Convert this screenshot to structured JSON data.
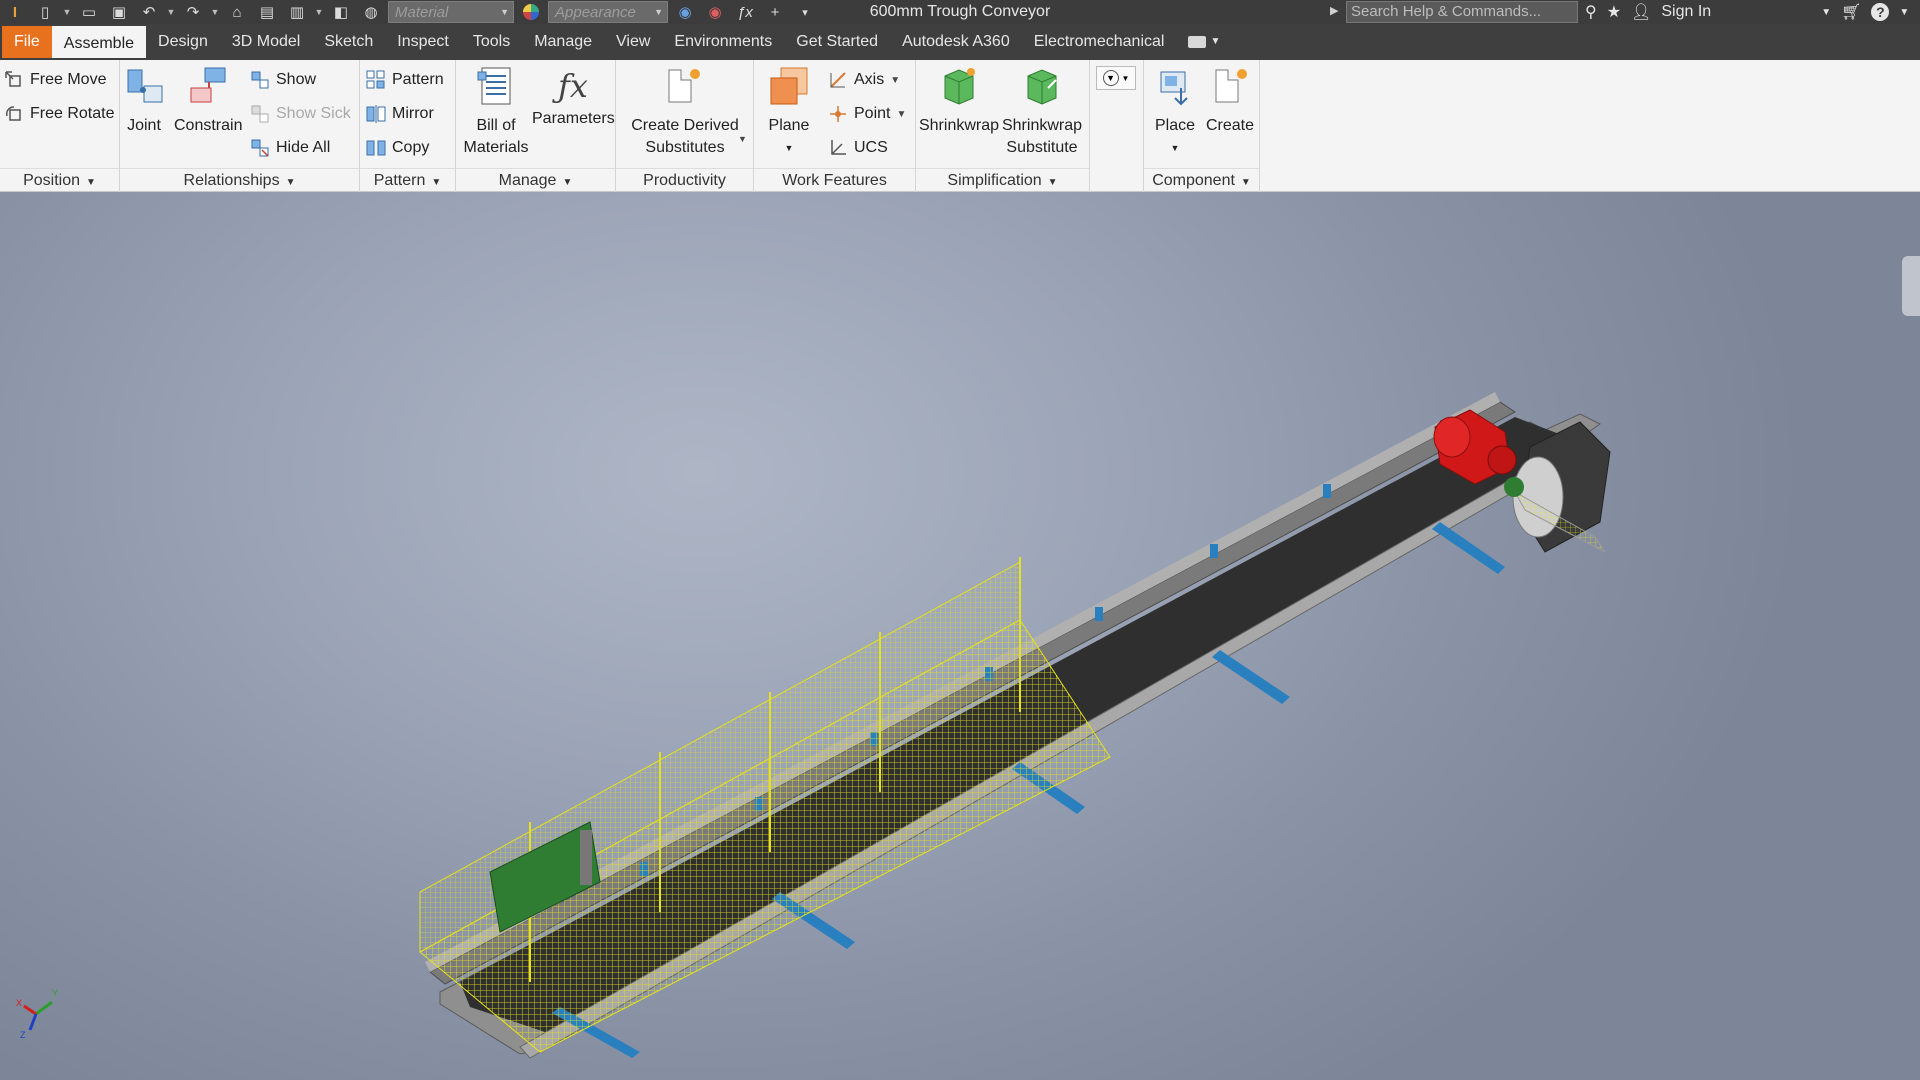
{
  "titlebar": {
    "document_title": "600mm Trough Conveyor",
    "material_placeholder": "Material",
    "appearance_placeholder": "Appearance",
    "search_placeholder": "Search Help & Commands...",
    "sign_in": "Sign In",
    "help": "?"
  },
  "tabs": [
    "File",
    "Assemble",
    "Design",
    "3D Model",
    "Sketch",
    "Inspect",
    "Tools",
    "Manage",
    "View",
    "Environments",
    "Get Started",
    "Autodesk A360",
    "Electromechanical"
  ],
  "active_tab": "Assemble",
  "ribbon": {
    "position": {
      "title": "Position",
      "free_move": "Free Move",
      "free_rotate": "Free Rotate"
    },
    "relationships": {
      "title": "Relationships",
      "joint": "Joint",
      "constrain": "Constrain",
      "show": "Show",
      "show_sick": "Show Sick",
      "hide_all": "Hide All"
    },
    "pattern": {
      "title": "Pattern",
      "pattern": "Pattern",
      "mirror": "Mirror",
      "copy": "Copy"
    },
    "manage": {
      "title": "Manage",
      "bom_line1": "Bill of",
      "bom_line2": "Materials",
      "parameters": "Parameters"
    },
    "productivity": {
      "title": "Productivity",
      "cds_line1": "Create Derived",
      "cds_line2": "Substitutes"
    },
    "work_features": {
      "title": "Work Features",
      "plane": "Plane",
      "axis": "Axis",
      "point": "Point",
      "ucs": "UCS"
    },
    "simplification": {
      "title": "Simplification",
      "shrinkwrap": "Shrinkwrap",
      "sws_line1": "Shrinkwrap",
      "sws_line2": "Substitute"
    },
    "component": {
      "title": "Component",
      "place": "Place",
      "create": "Create"
    }
  },
  "triad": {
    "x": "X",
    "y": "Y",
    "z": "Z"
  },
  "colors": {
    "file_tab": "#e8711e",
    "motor": "#d11818",
    "support": "#2a7fbf",
    "belt": "#2b2b2b",
    "mesh": "#e6e21a",
    "guard": "#2e7d32"
  }
}
